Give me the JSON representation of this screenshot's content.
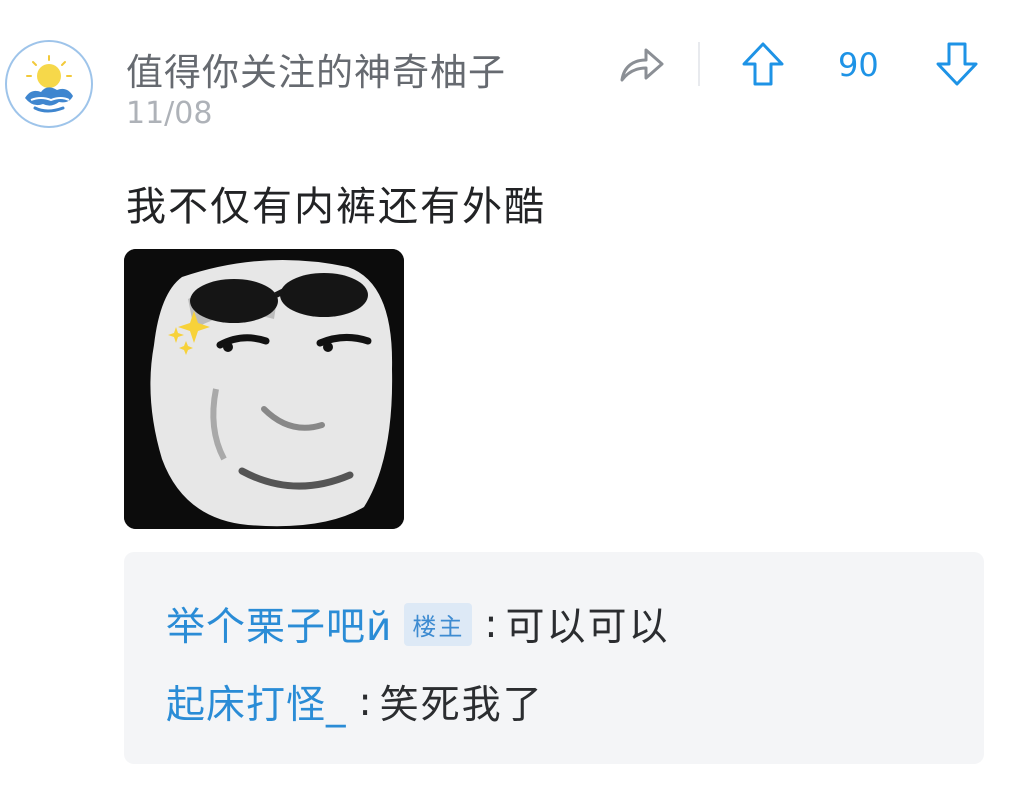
{
  "post": {
    "username": "值得你关注的神奇柚子",
    "date": "11/08",
    "vote_count": "90",
    "text": "我不仅有内裤还有外酷"
  },
  "icons": {
    "share": "share-arrow-icon",
    "upvote": "arrow-up-icon",
    "downvote": "arrow-down-icon"
  },
  "colors": {
    "accent": "#1e93e6",
    "reply_author": "#2a8cd6",
    "reply_bg": "#f4f5f7",
    "username": "#666a70"
  },
  "replies": [
    {
      "author": "举个栗子吧й",
      "badge": "楼主",
      "separator": ":",
      "text": "可以可以"
    },
    {
      "author": "起床打怪_",
      "separator": ":",
      "text": "笑死我了"
    }
  ]
}
